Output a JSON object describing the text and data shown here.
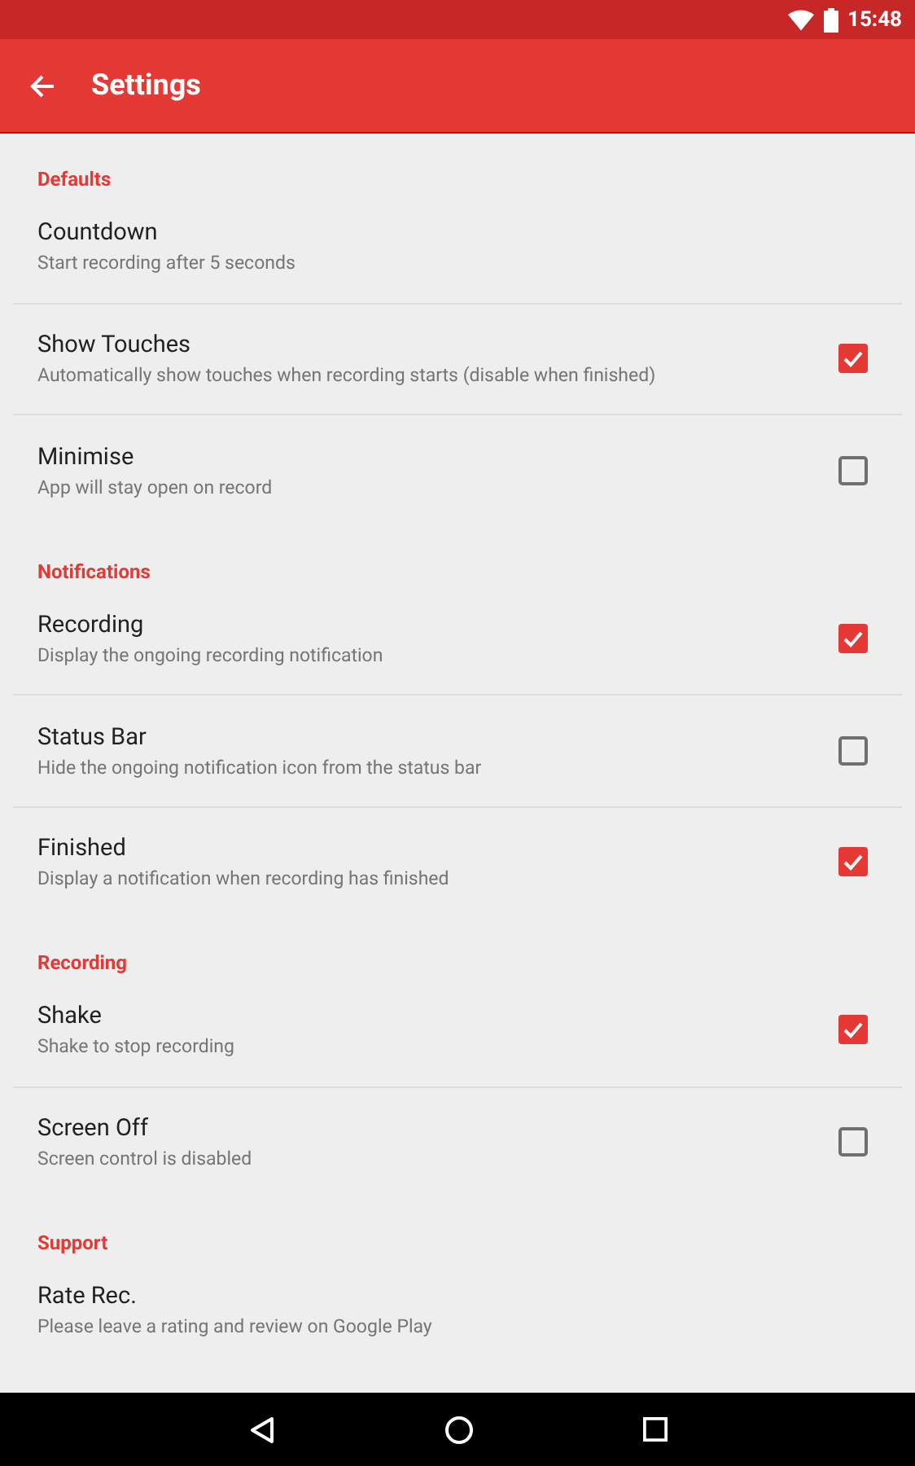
{
  "status_bar": {
    "time": "15:48"
  },
  "app_bar": {
    "title": "Settings"
  },
  "sections": [
    {
      "title": "Defaults",
      "items": [
        {
          "kind": "text",
          "title": "Countdown",
          "summary": "Start recording after 5 seconds"
        },
        {
          "kind": "checkbox",
          "title": "Show Touches",
          "summary": "Automatically show touches when recording starts (disable when finished)",
          "checked": true
        },
        {
          "kind": "checkbox",
          "title": "Minimise",
          "summary": "App will stay open on record",
          "checked": false
        }
      ]
    },
    {
      "title": "Notifications",
      "items": [
        {
          "kind": "checkbox",
          "title": "Recording",
          "summary": "Display the ongoing recording notification",
          "checked": true
        },
        {
          "kind": "checkbox",
          "title": "Status Bar",
          "summary": "Hide the ongoing notification icon from the status bar",
          "checked": false
        },
        {
          "kind": "checkbox",
          "title": "Finished",
          "summary": "Display a notification when recording has finished",
          "checked": true
        }
      ]
    },
    {
      "title": "Recording",
      "items": [
        {
          "kind": "checkbox",
          "title": "Shake",
          "summary": "Shake to stop recording",
          "checked": true
        },
        {
          "kind": "checkbox",
          "title": "Screen Off",
          "summary": "Screen control is disabled",
          "checked": false
        }
      ]
    },
    {
      "title": "Support",
      "items": [
        {
          "kind": "text",
          "title": "Rate Rec.",
          "summary": "Please leave a rating and review on Google Play"
        }
      ]
    }
  ]
}
